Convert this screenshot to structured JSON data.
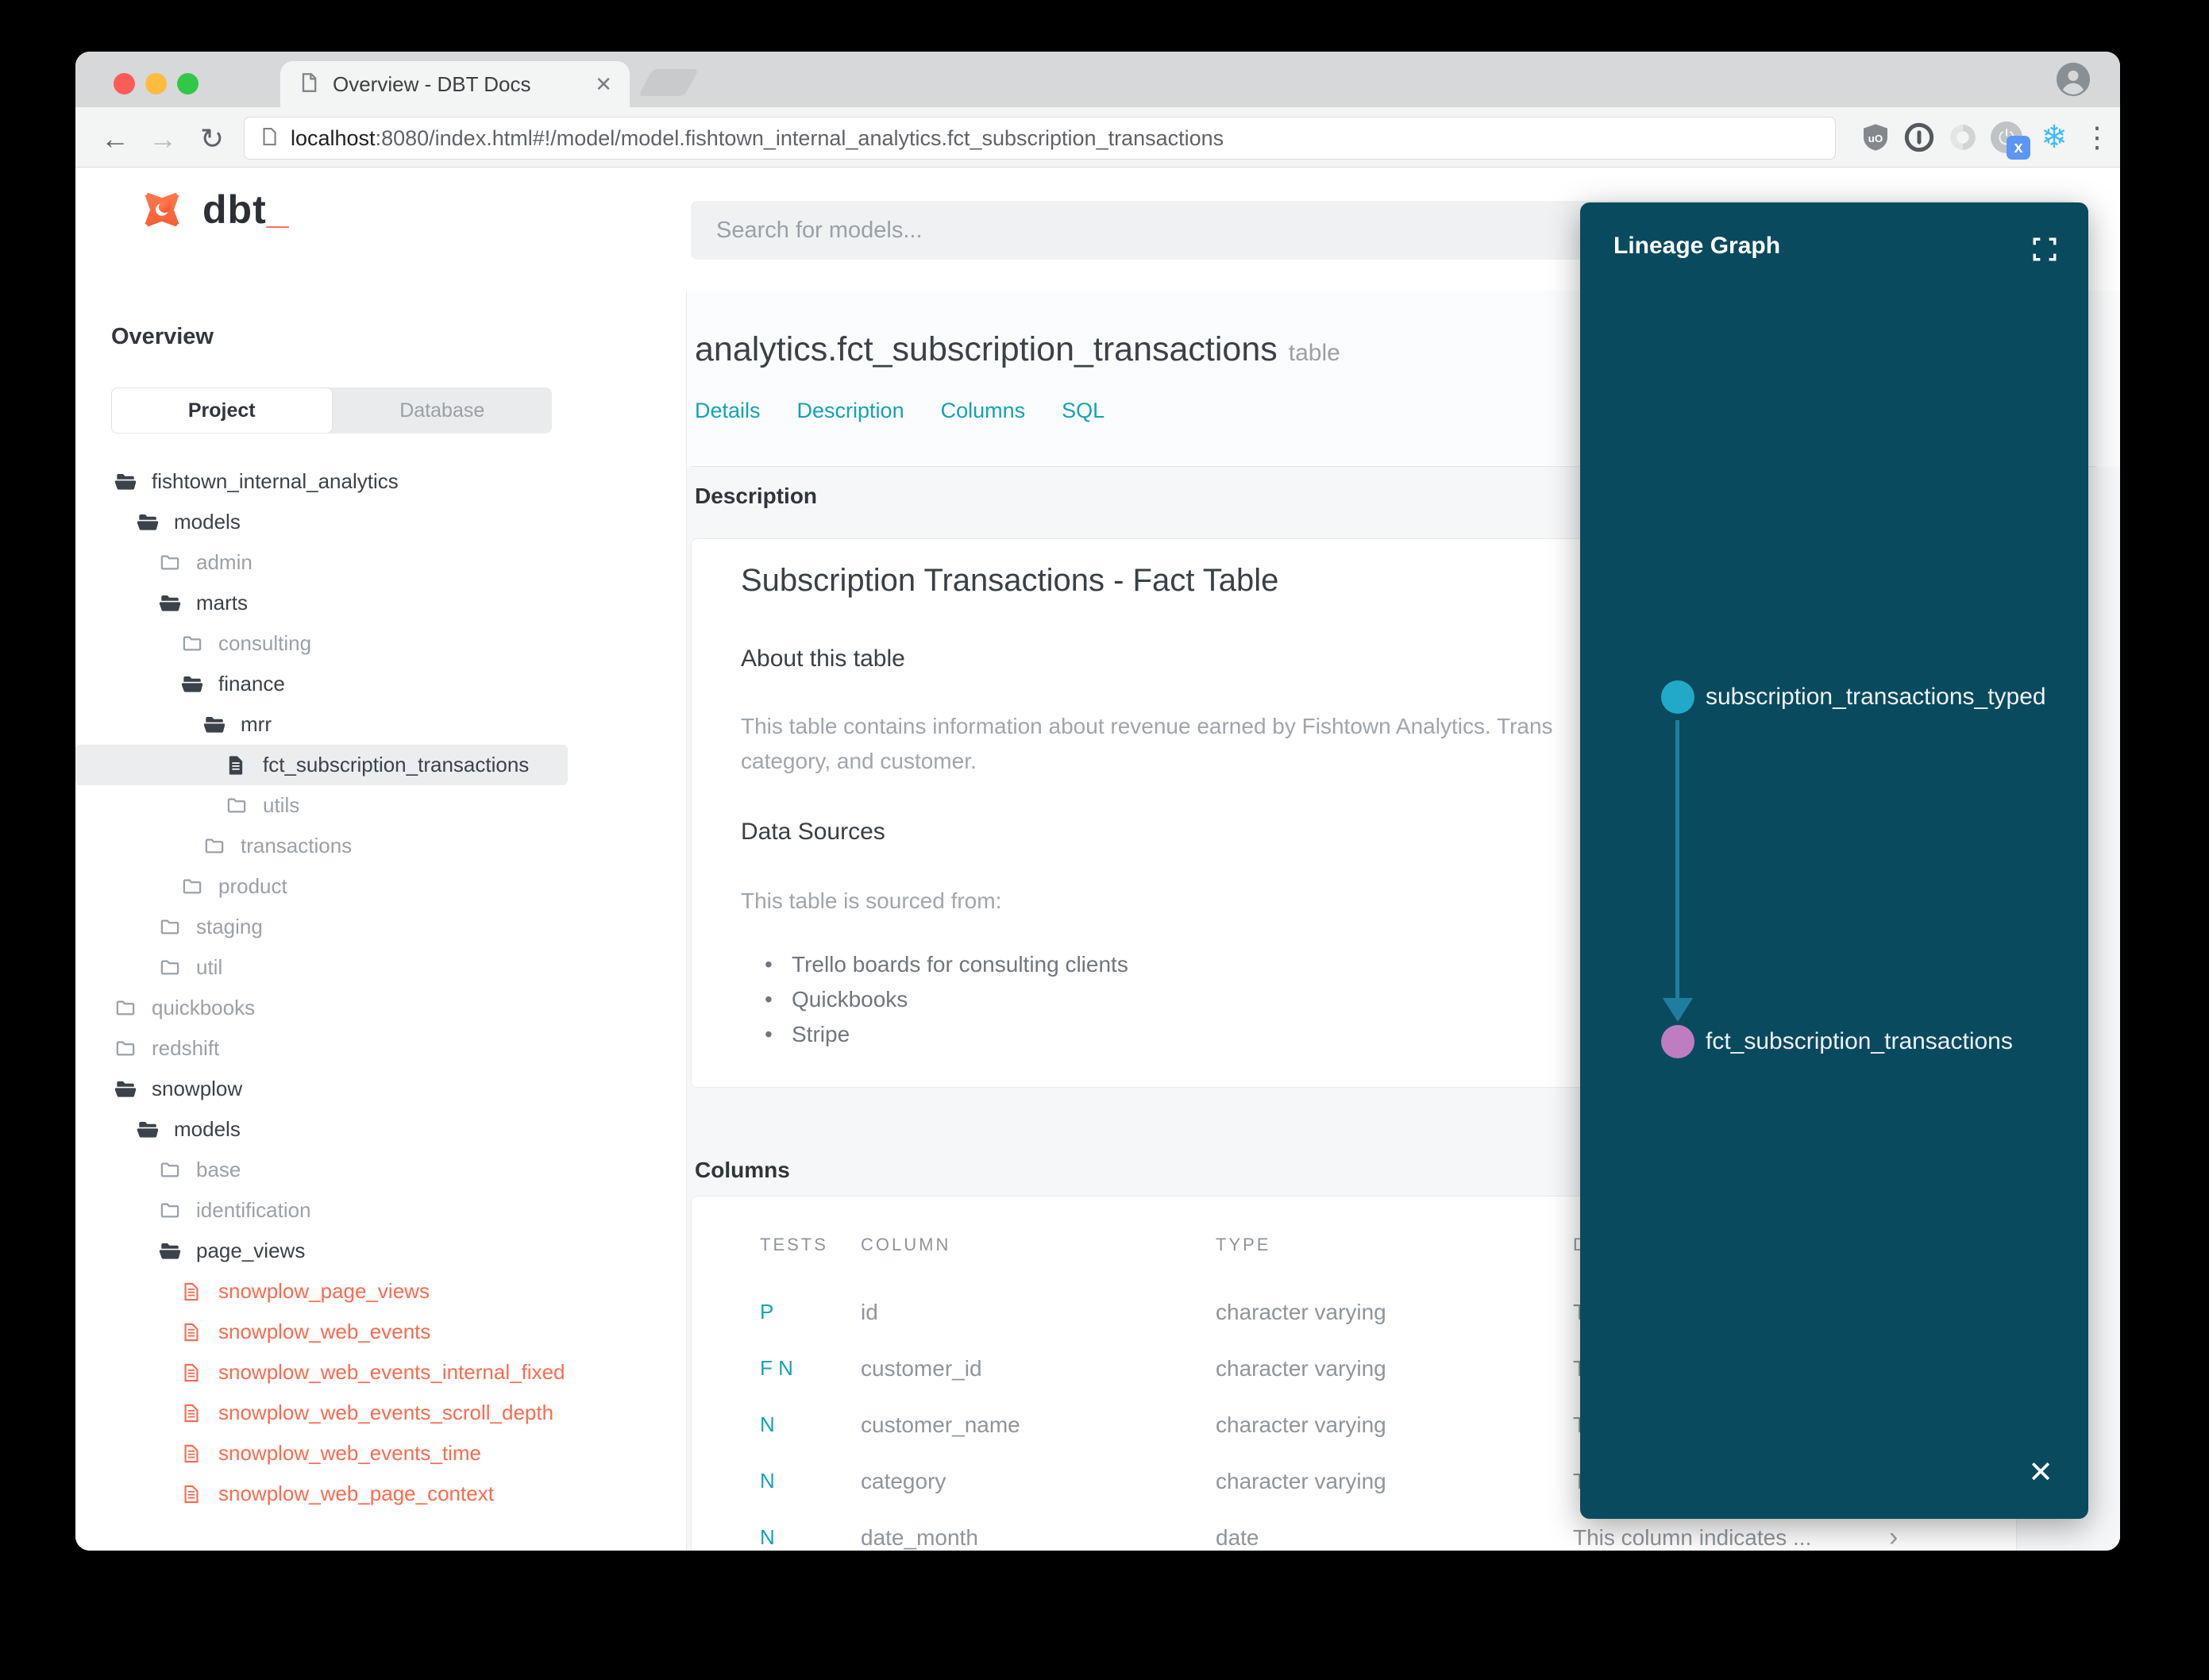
{
  "browser": {
    "tab_title": "Overview - DBT Docs",
    "url_host": "localhost",
    "url_rest": ":8080/index.html#!/model/model.fishtown_internal_analytics.fct_subscription_transactions"
  },
  "header": {
    "logo_dbt": "dbt",
    "logo_underscore": "_",
    "search_placeholder": "Search for models..."
  },
  "sidebar": {
    "heading": "Overview",
    "toggle": {
      "project": "Project",
      "database": "Database"
    },
    "tree": [
      {
        "label": "fishtown_internal_analytics",
        "level": 0,
        "icon": "folder-open",
        "tone": "dark"
      },
      {
        "label": "models",
        "level": 1,
        "icon": "folder-open",
        "tone": "dark"
      },
      {
        "label": "admin",
        "level": 2,
        "icon": "folder",
        "tone": "muted"
      },
      {
        "label": "marts",
        "level": 2,
        "icon": "folder-open",
        "tone": "dark"
      },
      {
        "label": "consulting",
        "level": 3,
        "icon": "folder",
        "tone": "muted"
      },
      {
        "label": "finance",
        "level": 3,
        "icon": "folder-open",
        "tone": "dark"
      },
      {
        "label": "mrr",
        "level": 4,
        "icon": "folder-open",
        "tone": "dark"
      },
      {
        "label": "fct_subscription_transactions",
        "level": 5,
        "icon": "file",
        "tone": "dark",
        "selected": true
      },
      {
        "label": "utils",
        "level": 5,
        "icon": "folder",
        "tone": "muted"
      },
      {
        "label": "transactions",
        "level": 4,
        "icon": "folder",
        "tone": "muted"
      },
      {
        "label": "product",
        "level": 3,
        "icon": "folder",
        "tone": "muted"
      },
      {
        "label": "staging",
        "level": 2,
        "icon": "folder",
        "tone": "muted"
      },
      {
        "label": "util",
        "level": 2,
        "icon": "folder",
        "tone": "muted"
      },
      {
        "label": "quickbooks",
        "level": 0,
        "icon": "folder",
        "tone": "muted"
      },
      {
        "label": "redshift",
        "level": 0,
        "icon": "folder",
        "tone": "muted"
      },
      {
        "label": "snowplow",
        "level": 0,
        "icon": "folder-open",
        "tone": "dark"
      },
      {
        "label": "models",
        "level": 1,
        "icon": "folder-open",
        "tone": "dark"
      },
      {
        "label": "base",
        "level": 2,
        "icon": "folder",
        "tone": "muted"
      },
      {
        "label": "identification",
        "level": 2,
        "icon": "folder",
        "tone": "muted"
      },
      {
        "label": "page_views",
        "level": 2,
        "icon": "folder-open",
        "tone": "dark"
      },
      {
        "label": "snowplow_page_views",
        "level": 3,
        "icon": "file-red",
        "tone": "red"
      },
      {
        "label": "snowplow_web_events",
        "level": 3,
        "icon": "file-red",
        "tone": "red"
      },
      {
        "label": "snowplow_web_events_internal_fixed",
        "level": 3,
        "icon": "file-red",
        "tone": "red"
      },
      {
        "label": "snowplow_web_events_scroll_depth",
        "level": 3,
        "icon": "file-red",
        "tone": "red"
      },
      {
        "label": "snowplow_web_events_time",
        "level": 3,
        "icon": "file-red",
        "tone": "red"
      },
      {
        "label": "snowplow_web_page_context",
        "level": 3,
        "icon": "file-red",
        "tone": "red"
      }
    ]
  },
  "main": {
    "title": "analytics.fct_subscription_transactions",
    "title_badge": "table",
    "tabs": [
      "Details",
      "Description",
      "Columns",
      "SQL"
    ],
    "sections": {
      "description_label": "Description",
      "columns_label": "Columns"
    },
    "doc": {
      "h1": "Subscription Transactions - Fact Table",
      "about_heading": "About this table",
      "about_line1": "This table contains information about revenue earned by Fishtown Analytics. Trans",
      "about_line2": "category, and customer.",
      "sources_heading": "Data Sources",
      "sources_intro": "This table is sourced from:",
      "sources": [
        "Trello boards for consulting clients",
        "Quickbooks",
        "Stripe"
      ]
    },
    "columns_table": {
      "headers": [
        "TESTS",
        "COLUMN",
        "TYPE",
        "DESCRIPTION"
      ],
      "rows": [
        {
          "tests": "P",
          "column": "id",
          "type": "character varying",
          "description": "This column indicates ..."
        },
        {
          "tests": "F N",
          "column": "customer_id",
          "type": "character varying",
          "description": "This column indicates ..."
        },
        {
          "tests": "N",
          "column": "customer_name",
          "type": "character varying",
          "description": "This column indicates ..."
        },
        {
          "tests": "N",
          "column": "category",
          "type": "character varying",
          "description": "This column indicates ..."
        },
        {
          "tests": "N",
          "column": "date_month",
          "type": "date",
          "description": "This column indicates ..."
        }
      ]
    }
  },
  "lineage": {
    "title": "Lineage Graph",
    "nodes": [
      {
        "label": "subscription_transactions_typed",
        "color": "#22a9ca"
      },
      {
        "label": "fct_subscription_transactions",
        "color": "#bd7dbe"
      }
    ]
  },
  "icons": {
    "back": "←",
    "forward": "→",
    "reload": "↻",
    "snowflake": "❄",
    "menu_dots": "⋮",
    "tab_close": "✕",
    "panel_close": "✕",
    "chevron": "›",
    "bullet": "•",
    "power_badge": "x"
  },
  "colors": {
    "accent_teal": "#13a3b5",
    "accent_red": "#fc6a4e",
    "lineage_bg": "#0a4a5f",
    "node_blue": "#22a9ca",
    "node_purple": "#bd7dbe",
    "tree_dark": "#3c424a",
    "tree_muted": "#9ba1a8"
  }
}
